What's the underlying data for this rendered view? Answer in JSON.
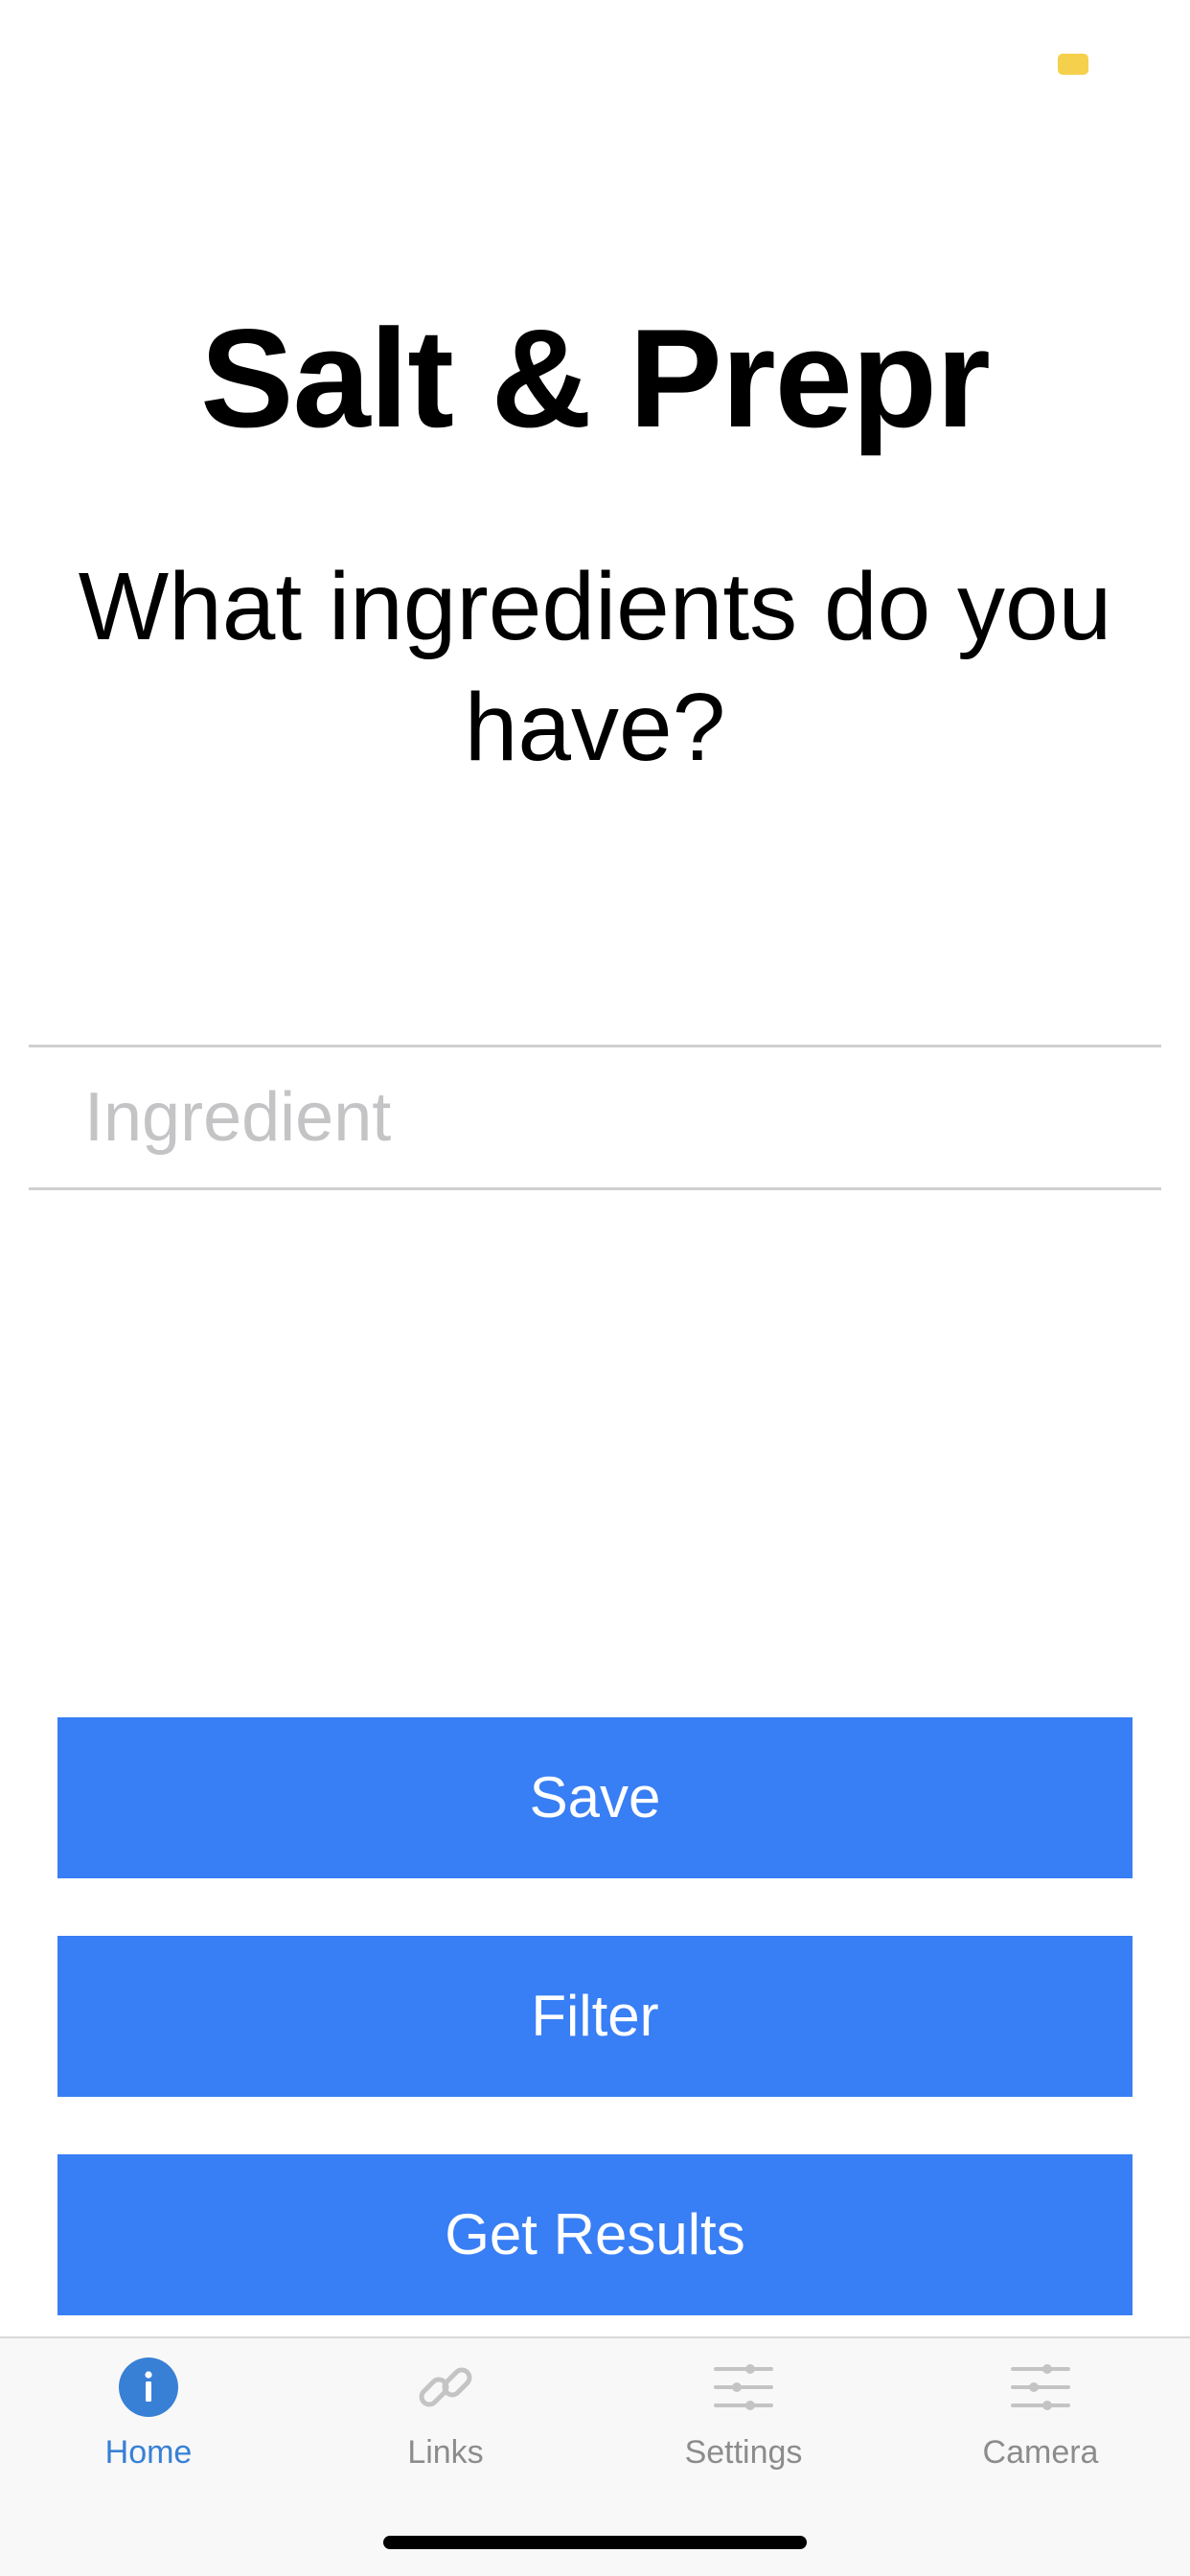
{
  "app": {
    "title": "Salt & Prepr",
    "prompt": "What ingredients do you have?"
  },
  "input": {
    "placeholder": "Ingredient",
    "value": ""
  },
  "buttons": {
    "save_label": "Save",
    "filter_label": "Filter",
    "results_label": "Get Results"
  },
  "tabbar": {
    "items": [
      {
        "label": "Home",
        "icon": "info-icon",
        "active": true
      },
      {
        "label": "Links",
        "icon": "link-icon",
        "active": false
      },
      {
        "label": "Settings",
        "icon": "sliders-icon",
        "active": false
      },
      {
        "label": "Camera",
        "icon": "sliders-icon",
        "active": false
      }
    ]
  },
  "colors": {
    "button": "#387ef5",
    "tab_active": "#3880d6",
    "tab_inactive": "#8c8c8c",
    "status_indicator": "#f5d04c"
  }
}
